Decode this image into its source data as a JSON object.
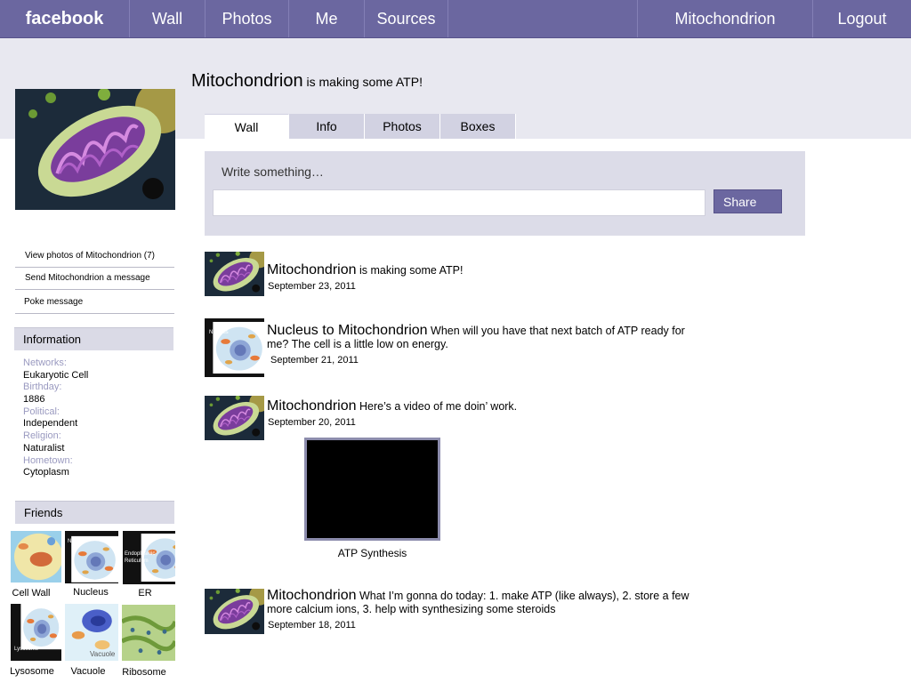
{
  "nav": {
    "logo": "facebook",
    "wall": "Wall",
    "photos": "Photos",
    "me": "Me",
    "sources": "Sources",
    "profile": "Mitochondrion",
    "logout": "Logout"
  },
  "profile": {
    "name": "Mitochondrion",
    "status": "is making some ATP!"
  },
  "tabs": [
    "Wall",
    "Info",
    "Photos",
    "Boxes"
  ],
  "publisher": {
    "label": "Write something…",
    "value": "",
    "share_label": "Share"
  },
  "left_links": [
    "View photos of Mitochondrion (7)",
    "Send Mitochondrion a message",
    "Poke message"
  ],
  "information": {
    "heading": "Information",
    "fields": [
      {
        "label": "Networks:",
        "value": "Eukaryotic  Cell"
      },
      {
        "label": "Birthday:",
        "value": "1886"
      },
      {
        "label": "Political:",
        "value": "Independent"
      },
      {
        "label": "Religion:",
        "value": "Naturalist"
      },
      {
        "label": "Hometown:",
        "value": "Cytoplasm"
      }
    ]
  },
  "friends": {
    "heading": "Friends",
    "items": [
      {
        "name": "Cell Wall"
      },
      {
        "name": "Nucleus",
        "thumb_text": "Nucleus"
      },
      {
        "name": "ER",
        "thumb_text": "Endoplasmic Reticulum"
      },
      {
        "name": "Lysosome",
        "thumb_text": "Lysosome"
      },
      {
        "name": "Vacuole",
        "thumb_text": "Vacuole"
      },
      {
        "name": "Ribosome"
      }
    ]
  },
  "posts": [
    {
      "name": "Mitochondrion",
      "text": "is making some ATP!",
      "date": "September 23, 2011"
    },
    {
      "name": "Nucleus to Mitochondrion",
      "text": "When will you have that next batch of ATP ready for me? The cell is a little low on energy.",
      "date": "September 21, 2011",
      "thumb_text": "Nucleus"
    },
    {
      "name": "Mitochondrion",
      "text": "Here’s a video of me doin’ work.",
      "date": "September 20, 2011"
    },
    {
      "name": "Mitochondrion",
      "text": "What I’m gonna do today: 1. make ATP (like always), 2. store a few more calcium ions, 3. help with synthesizing some steroids",
      "date": "September 18, 2011"
    }
  ],
  "video": {
    "caption": "ATP Synthesis"
  },
  "colors": {
    "nav_bg": "#6b67a0",
    "header_band": "#e8e8f0",
    "tab_inactive": "#d2d2e2",
    "publisher_bg": "#dcdce8",
    "info_label": "#9a9ac0"
  },
  "icons": {
    "profile_picture": "mitochondrion-image",
    "video": "video-player"
  }
}
